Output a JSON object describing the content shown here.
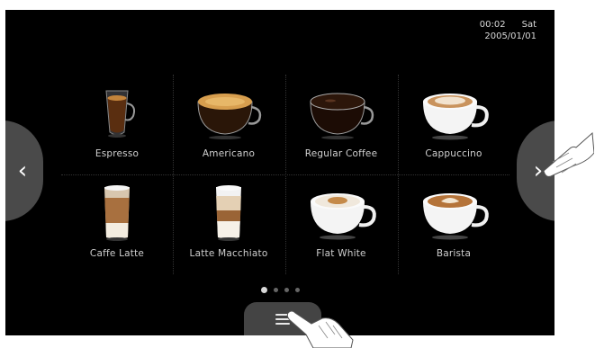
{
  "status": {
    "time": "00:02",
    "day": "Sat",
    "date": "2005/01/01"
  },
  "products": [
    {
      "label": "Espresso",
      "icon": "espresso-glass-icon"
    },
    {
      "label": "Americano",
      "icon": "americano-glass-icon"
    },
    {
      "label": "Regular Coffee",
      "icon": "regular-coffee-glass-icon"
    },
    {
      "label": "Cappuccino",
      "icon": "cappuccino-cup-icon"
    },
    {
      "label": "Caffe Latte",
      "icon": "latte-glass-icon"
    },
    {
      "label": "Latte Macchiato",
      "icon": "latte-macchiato-glass-icon"
    },
    {
      "label": "Flat White",
      "icon": "flat-white-cup-icon"
    },
    {
      "label": "Barista",
      "icon": "barista-cup-icon"
    }
  ],
  "nav": {
    "prev_icon": "‹",
    "next_icon": "›"
  },
  "pagination": {
    "current": 1,
    "total": 4
  },
  "menu": {
    "icon": "menu-icon"
  },
  "colors": {
    "screen": "#000000",
    "button": "#4a4a4a",
    "text": "#cfcfcf"
  }
}
